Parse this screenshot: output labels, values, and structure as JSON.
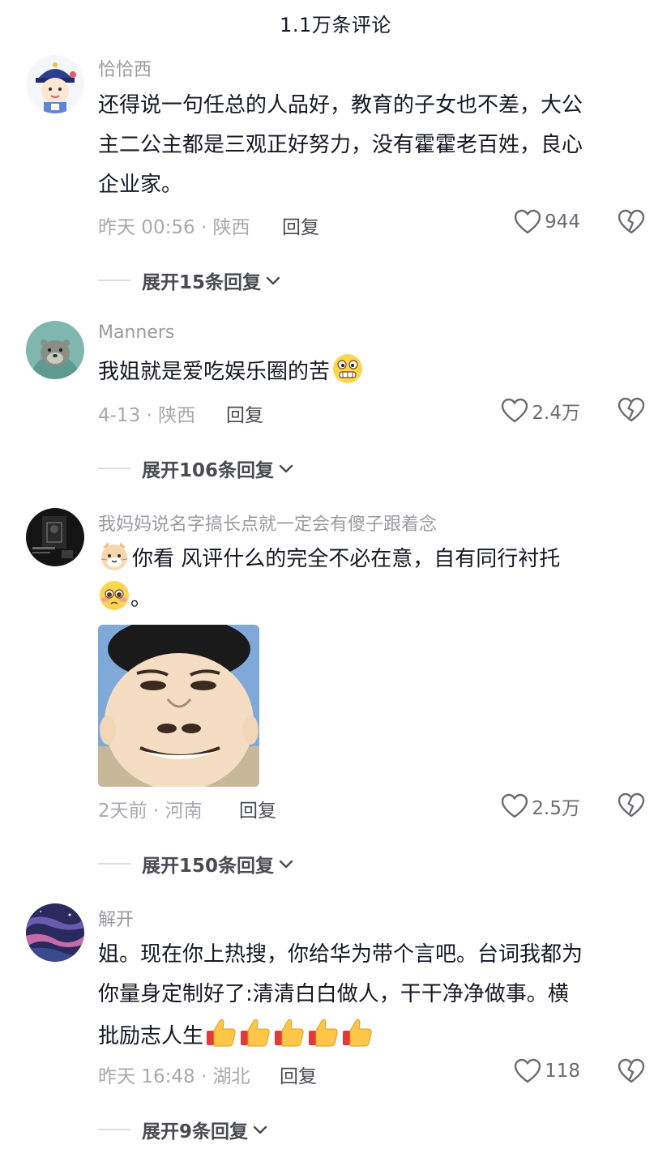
{
  "header": {
    "title": "1.1万条评论"
  },
  "comments": [
    {
      "username": "恰恰西",
      "lines": [
        "还得说一句任总的人品好，教育的子女也不差，大公",
        "主二公主都是三观正好努力，没有霍霍老百姓，良心",
        "企业家。"
      ],
      "meta": "昨天 00:56 · 陕西",
      "reply_label": "回复",
      "likes": "944",
      "expand_label": "展开15条回复",
      "avatar_icon": "cartoon-qing-official-avatar"
    },
    {
      "username": "Manners",
      "lines": [
        "我姐就是爱吃娱乐圈的苦"
      ],
      "emoji": "grimace-emoji",
      "meta": "4-13 · 陕西",
      "reply_label": "回复",
      "likes": "2.4万",
      "expand_label": "展开106条回复",
      "avatar_icon": "otter-avatar"
    },
    {
      "username": "我妈妈说名字搞长点就一定会有傻子跟着念",
      "lines": [
        "你看 风评什么的完全不必在意，自有同行衬托",
        "。"
      ],
      "emoji_start": "cat-emoji",
      "emoji_line2": "pleading-emoji",
      "meta": "2天前 · 河南",
      "reply_label": "回复",
      "likes": "2.5万",
      "expand_label": "展开150条回复",
      "avatar_icon": "dark-photo-avatar",
      "image": "distorted-face-meme"
    },
    {
      "username": "解开",
      "lines": [
        "姐。现在你上热搜，你给华为带个言吧。台词我都为",
        "你量身定制好了:清清白白做人，干干净净做事。横",
        "批励志人生"
      ],
      "emoji_thumbs": 5,
      "meta": "昨天 16:48 · 湖北",
      "reply_label": "回复",
      "likes": "118",
      "expand_label": "展开9条回复",
      "avatar_icon": "purple-nebula-avatar"
    }
  ],
  "colors": {
    "primary_text": "#161823",
    "secondary_text": "#9a9ba0",
    "action_text": "#4a4b52"
  }
}
